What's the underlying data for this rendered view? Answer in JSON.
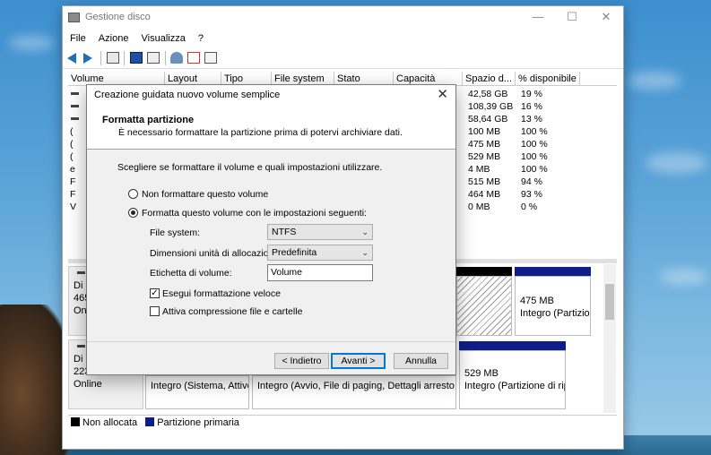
{
  "window": {
    "title": "Gestione disco",
    "controls": [
      "—",
      "☐",
      "✕"
    ]
  },
  "menu": [
    "File",
    "Azione",
    "Visualizza",
    "?"
  ],
  "table": {
    "columns": [
      "Volume",
      "Layout",
      "Tipo",
      "File system",
      "Stato",
      "Capacità",
      "Spazio d...",
      "% disponibile"
    ],
    "rows": [
      {
        "prefix": "",
        "spazio": "42,58 GB",
        "perc": "19 %"
      },
      {
        "prefix": "",
        "spazio": "108,39 GB",
        "perc": "16 %"
      },
      {
        "prefix": "",
        "spazio": "58,64 GB",
        "perc": "13 %"
      },
      {
        "prefix": "(",
        "spazio": "100 MB",
        "perc": "100 %"
      },
      {
        "prefix": "(",
        "spazio": "475 MB",
        "perc": "100 %"
      },
      {
        "prefix": "(",
        "spazio": "529 MB",
        "perc": "100 %"
      },
      {
        "prefix": "e",
        "spazio": "4 MB",
        "perc": "100 %"
      },
      {
        "prefix": "F",
        "spazio": "515 MB",
        "perc": "94 %"
      },
      {
        "prefix": "F",
        "spazio": "464 MB",
        "perc": "93 %"
      },
      {
        "prefix": "V",
        "spazio": "0 MB",
        "perc": "0 %"
      }
    ]
  },
  "disks": [
    {
      "line1": "Di",
      "line2": "465",
      "line3": "On",
      "part_size": "475 MB",
      "part_status": "Integro (Partizion"
    },
    {
      "line1": "Di",
      "line2": "223",
      "line3": "Online",
      "partA": "Integro (Sistema, Attivo,",
      "partB": "Integro (Avvio, File di paging, Dettagli arresto anor",
      "part_size": "529 MB",
      "part_status": "Integro (Partizione di rip"
    }
  ],
  "legend": {
    "unallocated": "Non allocata",
    "primary": "Partizione primaria",
    "unallocated_color": "#000000",
    "primary_color": "#0f1d8a"
  },
  "dialog": {
    "title": "Creazione guidata nuovo volume semplice",
    "close": "✕",
    "header_title": "Formatta partizione",
    "header_desc": "È necessario formattare la partizione prima di potervi archiviare dati.",
    "intro": "Scegliere se formattare il volume e quali impostazioni utilizzare.",
    "radio_no_format": "Non formattare questo volume",
    "radio_format": "Formatta questo volume con le impostazioni seguenti:",
    "selected_option": "format",
    "fs_label": "File system:",
    "fs_value": "NTFS",
    "alloc_label": "Dimensioni unità di allocazione:",
    "alloc_value": "Predefinita",
    "vol_label_label": "Etichetta di volume:",
    "vol_label_value": "Volume",
    "quick_format_label": "Esegui formattazione veloce",
    "quick_format_checked": true,
    "compression_label": "Attiva compressione file e cartelle",
    "compression_checked": false,
    "btn_back": "< Indietro",
    "btn_next": "Avanti >",
    "btn_cancel": "Annulla"
  }
}
